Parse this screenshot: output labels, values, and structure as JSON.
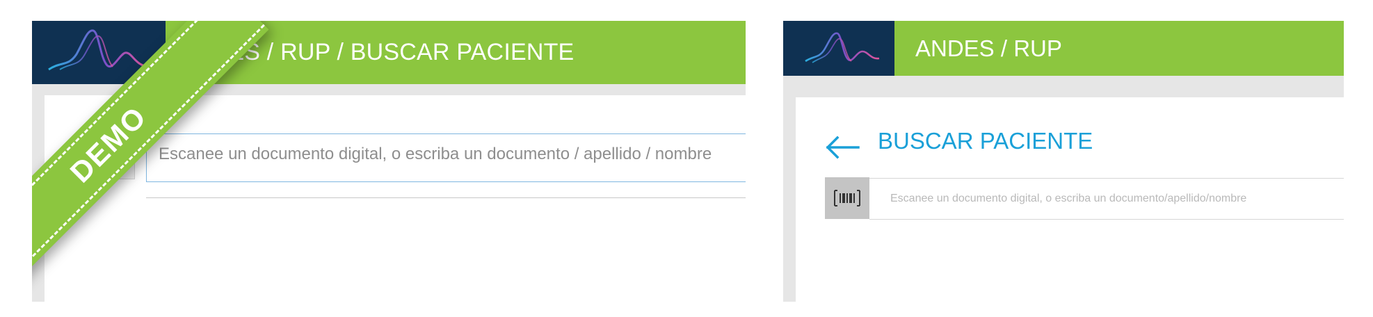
{
  "left_panel": {
    "header_title": "ANDES / RUP / BUSCAR PACIENTE",
    "search_placeholder": "Escanee un documento digital, o escriba un documento / apellido / nombre",
    "ribbon_text": "DEMO",
    "icons": {
      "logo": "andes-wave-logo-icon",
      "scan": "barcode-scan-icon"
    }
  },
  "right_panel": {
    "header_title": "ANDES / RUP",
    "page_title": "BUSCAR PACIENTE",
    "search_placeholder": "Escanee un documento digital, o escriba un documento/apellido/nombre",
    "icons": {
      "logo": "andes-wave-logo-icon",
      "back": "back-arrow-icon",
      "scan": "barcode-scan-icon"
    }
  },
  "colors": {
    "header_green": "#8cc63f",
    "logo_navy": "#0f3152",
    "title_blue": "#1aa0d8",
    "background_gray": "#e6e6e6"
  }
}
